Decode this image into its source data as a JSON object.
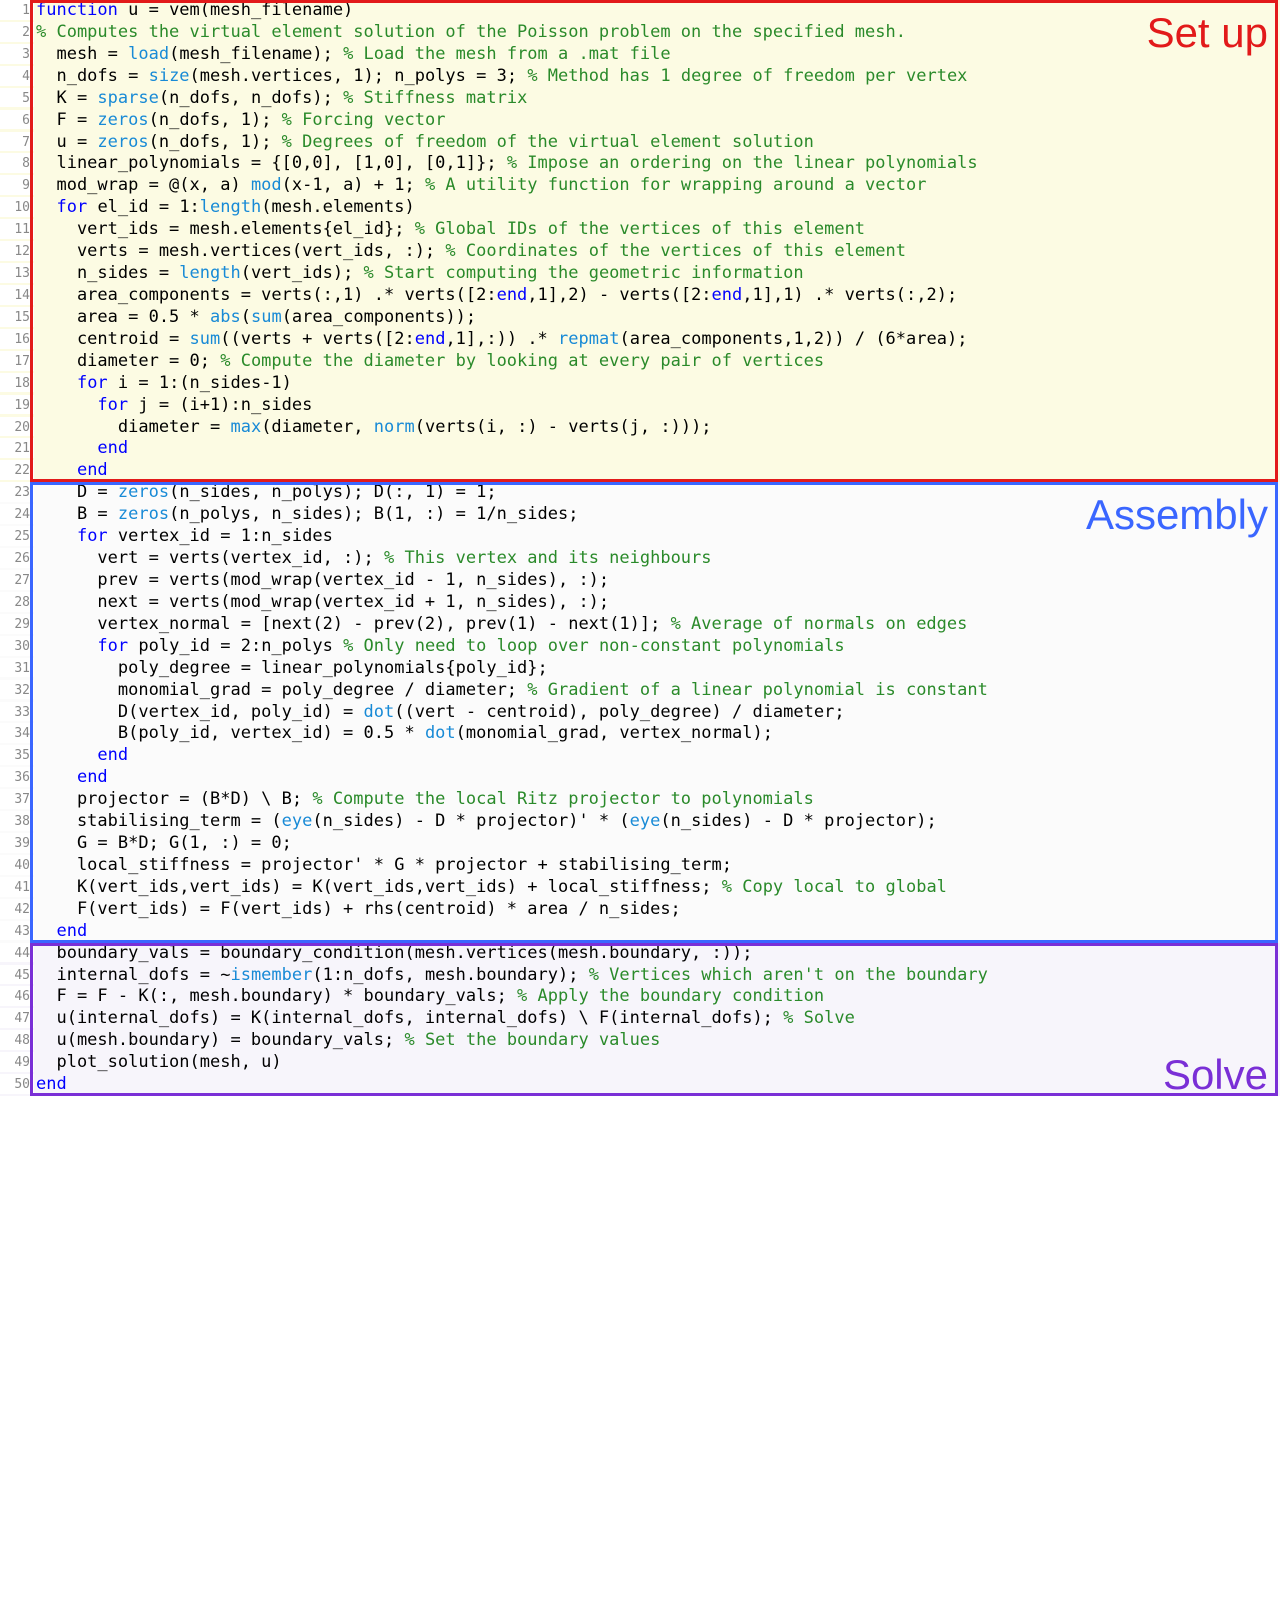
{
  "sections": {
    "setup": {
      "label": "Set up",
      "start": 1,
      "end": 22,
      "bg": "bg-setup",
      "box": "box-setup",
      "labelClass": "label-setup",
      "labelTop": 6
    },
    "assembly": {
      "label": "Assembly",
      "start": 23,
      "end": 43,
      "bg": "bg-assembly",
      "box": "box-assembly",
      "labelClass": "label-assembly",
      "labelTop": 6
    },
    "solve": {
      "label": "Solve",
      "start": 44,
      "end": 50,
      "bg": "bg-solve",
      "box": "box-solve",
      "labelClass": "label-solve",
      "labelBottom": 2
    }
  },
  "lines": [
    {
      "n": 1,
      "sec": "setup",
      "t": [
        [
          "kw",
          "function"
        ],
        [
          "",
          " u = vem(mesh_filename)"
        ]
      ]
    },
    {
      "n": 2,
      "sec": "setup",
      "t": [
        [
          "cm",
          "% Computes the virtual element solution of the Poisson problem on the specified mesh."
        ]
      ]
    },
    {
      "n": 3,
      "sec": "setup",
      "t": [
        [
          "",
          "  mesh = "
        ],
        [
          "fn",
          "load"
        ],
        [
          "",
          "(mesh_filename); "
        ],
        [
          "cm",
          "% Load the mesh from a .mat file"
        ]
      ]
    },
    {
      "n": 4,
      "sec": "setup",
      "t": [
        [
          "",
          "  n_dofs = "
        ],
        [
          "fn",
          "size"
        ],
        [
          "",
          "(mesh.vertices, 1); n_polys = 3; "
        ],
        [
          "cm",
          "% Method has 1 degree of freedom per vertex"
        ]
      ]
    },
    {
      "n": 5,
      "sec": "setup",
      "t": [
        [
          "",
          "  K = "
        ],
        [
          "fn",
          "sparse"
        ],
        [
          "",
          "(n_dofs, n_dofs); "
        ],
        [
          "cm",
          "% Stiffness matrix"
        ]
      ]
    },
    {
      "n": 6,
      "sec": "setup",
      "t": [
        [
          "",
          "  F = "
        ],
        [
          "fn",
          "zeros"
        ],
        [
          "",
          "(n_dofs, 1); "
        ],
        [
          "cm",
          "% Forcing vector"
        ]
      ]
    },
    {
      "n": 7,
      "sec": "setup",
      "t": [
        [
          "",
          "  u = "
        ],
        [
          "fn",
          "zeros"
        ],
        [
          "",
          "(n_dofs, 1); "
        ],
        [
          "cm",
          "% Degrees of freedom of the virtual element solution"
        ]
      ]
    },
    {
      "n": 8,
      "sec": "setup",
      "t": [
        [
          "",
          "  linear_polynomials = {[0,0], [1,0], [0,1]}; "
        ],
        [
          "cm",
          "% Impose an ordering on the linear polynomials"
        ]
      ]
    },
    {
      "n": 9,
      "sec": "setup",
      "t": [
        [
          "",
          "  mod_wrap = @(x, a) "
        ],
        [
          "fn",
          "mod"
        ],
        [
          "",
          "(x-1, a) + 1; "
        ],
        [
          "cm",
          "% A utility function for wrapping around a vector"
        ]
      ]
    },
    {
      "n": 10,
      "sec": "setup",
      "t": [
        [
          "",
          "  "
        ],
        [
          "kw",
          "for"
        ],
        [
          "",
          " el_id = 1:"
        ],
        [
          "fn",
          "length"
        ],
        [
          "",
          "(mesh.elements)"
        ]
      ]
    },
    {
      "n": 11,
      "sec": "setup",
      "t": [
        [
          "",
          "    vert_ids = mesh.elements{el_id}; "
        ],
        [
          "cm",
          "% Global IDs of the vertices of this element"
        ]
      ]
    },
    {
      "n": 12,
      "sec": "setup",
      "t": [
        [
          "",
          "    verts = mesh.vertices(vert_ids, :); "
        ],
        [
          "cm",
          "% Coordinates of the vertices of this element"
        ]
      ]
    },
    {
      "n": 13,
      "sec": "setup",
      "t": [
        [
          "",
          "    n_sides = "
        ],
        [
          "fn",
          "length"
        ],
        [
          "",
          "(vert_ids); "
        ],
        [
          "cm",
          "% Start computing the geometric information"
        ]
      ]
    },
    {
      "n": 14,
      "sec": "setup",
      "t": [
        [
          "",
          "    area_components = verts(:,1) .* verts([2:"
        ],
        [
          "kw",
          "end"
        ],
        [
          "",
          ",1],2) - verts([2:"
        ],
        [
          "kw",
          "end"
        ],
        [
          "",
          ",1],1) .* verts(:,2);"
        ]
      ]
    },
    {
      "n": 15,
      "sec": "setup",
      "t": [
        [
          "",
          "    area = 0.5 * "
        ],
        [
          "fn",
          "abs"
        ],
        [
          "",
          "("
        ],
        [
          "fn",
          "sum"
        ],
        [
          "",
          "(area_components));"
        ]
      ]
    },
    {
      "n": 16,
      "sec": "setup",
      "t": [
        [
          "",
          "    centroid = "
        ],
        [
          "fn",
          "sum"
        ],
        [
          "",
          "((verts + verts([2:"
        ],
        [
          "kw",
          "end"
        ],
        [
          "",
          ",1],:)) .* "
        ],
        [
          "fn",
          "repmat"
        ],
        [
          "",
          "(area_components,1,2)) / (6*area);"
        ]
      ]
    },
    {
      "n": 17,
      "sec": "setup",
      "t": [
        [
          "",
          "    diameter = 0; "
        ],
        [
          "cm",
          "% Compute the diameter by looking at every pair of vertices"
        ]
      ]
    },
    {
      "n": 18,
      "sec": "setup",
      "t": [
        [
          "",
          "    "
        ],
        [
          "kw",
          "for"
        ],
        [
          "",
          " i = 1:(n_sides-1)"
        ]
      ]
    },
    {
      "n": 19,
      "sec": "setup",
      "t": [
        [
          "",
          "      "
        ],
        [
          "kw",
          "for"
        ],
        [
          "",
          " j = (i+1):n_sides"
        ]
      ]
    },
    {
      "n": 20,
      "sec": "setup",
      "t": [
        [
          "",
          "        diameter = "
        ],
        [
          "fn",
          "max"
        ],
        [
          "",
          "(diameter, "
        ],
        [
          "fn",
          "norm"
        ],
        [
          "",
          "(verts(i, :) - verts(j, :)));"
        ]
      ]
    },
    {
      "n": 21,
      "sec": "setup",
      "t": [
        [
          "",
          "      "
        ],
        [
          "kw",
          "end"
        ]
      ]
    },
    {
      "n": 22,
      "sec": "setup",
      "t": [
        [
          "",
          "    "
        ],
        [
          "kw",
          "end"
        ]
      ]
    },
    {
      "n": 23,
      "sec": "assembly",
      "t": [
        [
          "",
          "    D = "
        ],
        [
          "fn",
          "zeros"
        ],
        [
          "",
          "(n_sides, n_polys); D(:, 1) = 1;"
        ]
      ]
    },
    {
      "n": 24,
      "sec": "assembly",
      "t": [
        [
          "",
          "    B = "
        ],
        [
          "fn",
          "zeros"
        ],
        [
          "",
          "(n_polys, n_sides); B(1, :) = 1/n_sides;"
        ]
      ]
    },
    {
      "n": 25,
      "sec": "assembly",
      "t": [
        [
          "",
          "    "
        ],
        [
          "kw",
          "for"
        ],
        [
          "",
          " vertex_id = 1:n_sides"
        ]
      ]
    },
    {
      "n": 26,
      "sec": "assembly",
      "t": [
        [
          "",
          "      vert = verts(vertex_id, :); "
        ],
        [
          "cm",
          "% This vertex and its neighbours"
        ]
      ]
    },
    {
      "n": 27,
      "sec": "assembly",
      "t": [
        [
          "",
          "      prev = verts(mod_wrap(vertex_id - 1, n_sides), :);"
        ]
      ]
    },
    {
      "n": 28,
      "sec": "assembly",
      "t": [
        [
          "",
          "      next = verts(mod_wrap(vertex_id + 1, n_sides), :);"
        ]
      ]
    },
    {
      "n": 29,
      "sec": "assembly",
      "t": [
        [
          "",
          "      vertex_normal = [next(2) - prev(2), prev(1) - next(1)]; "
        ],
        [
          "cm",
          "% Average of normals on edges"
        ]
      ]
    },
    {
      "n": 30,
      "sec": "assembly",
      "t": [
        [
          "",
          "      "
        ],
        [
          "kw",
          "for"
        ],
        [
          "",
          " poly_id = 2:n_polys "
        ],
        [
          "cm",
          "% Only need to loop over non-constant polynomials"
        ]
      ]
    },
    {
      "n": 31,
      "sec": "assembly",
      "t": [
        [
          "",
          "        poly_degree = linear_polynomials{poly_id};"
        ]
      ]
    },
    {
      "n": 32,
      "sec": "assembly",
      "t": [
        [
          "",
          "        monomial_grad = poly_degree / diameter; "
        ],
        [
          "cm",
          "% Gradient of a linear polynomial is constant"
        ]
      ]
    },
    {
      "n": 33,
      "sec": "assembly",
      "t": [
        [
          "",
          "        D(vertex_id, poly_id) = "
        ],
        [
          "fn",
          "dot"
        ],
        [
          "",
          "((vert - centroid), poly_degree) / diameter;"
        ]
      ]
    },
    {
      "n": 34,
      "sec": "assembly",
      "t": [
        [
          "",
          "        B(poly_id, vertex_id) = 0.5 * "
        ],
        [
          "fn",
          "dot"
        ],
        [
          "",
          "(monomial_grad, vertex_normal);"
        ]
      ]
    },
    {
      "n": 35,
      "sec": "assembly",
      "t": [
        [
          "",
          "      "
        ],
        [
          "kw",
          "end"
        ]
      ]
    },
    {
      "n": 36,
      "sec": "assembly",
      "t": [
        [
          "",
          "    "
        ],
        [
          "kw",
          "end"
        ]
      ]
    },
    {
      "n": 37,
      "sec": "assembly",
      "t": [
        [
          "",
          "    projector = (B*D) \\ B; "
        ],
        [
          "cm",
          "% Compute the local Ritz projector to polynomials"
        ]
      ]
    },
    {
      "n": 38,
      "sec": "assembly",
      "t": [
        [
          "",
          "    stabilising_term = ("
        ],
        [
          "fn",
          "eye"
        ],
        [
          "",
          "(n_sides) - D * projector)' * ("
        ],
        [
          "fn",
          "eye"
        ],
        [
          "",
          "(n_sides) - D * projector);"
        ]
      ]
    },
    {
      "n": 39,
      "sec": "assembly",
      "t": [
        [
          "",
          "    G = B*D; G(1, :) = 0;"
        ]
      ]
    },
    {
      "n": 40,
      "sec": "assembly",
      "t": [
        [
          "",
          "    local_stiffness = projector' * G * projector + stabilising_term;"
        ]
      ]
    },
    {
      "n": 41,
      "sec": "assembly",
      "t": [
        [
          "",
          "    K(vert_ids,vert_ids) = K(vert_ids,vert_ids) + local_stiffness; "
        ],
        [
          "cm",
          "% Copy local to global"
        ]
      ]
    },
    {
      "n": 42,
      "sec": "assembly",
      "t": [
        [
          "",
          "    F(vert_ids) = F(vert_ids) + rhs(centroid) * area / n_sides;"
        ]
      ]
    },
    {
      "n": 43,
      "sec": "assembly",
      "t": [
        [
          "",
          "  "
        ],
        [
          "kw",
          "end"
        ]
      ]
    },
    {
      "n": 44,
      "sec": "solve",
      "t": [
        [
          "",
          "  boundary_vals = boundary_condition(mesh.vertices(mesh.boundary, :));"
        ]
      ]
    },
    {
      "n": 45,
      "sec": "solve",
      "t": [
        [
          "",
          "  internal_dofs = ~"
        ],
        [
          "fn",
          "ismember"
        ],
        [
          "",
          "(1:n_dofs, mesh.boundary); "
        ],
        [
          "cm",
          "% Vertices which aren't on the boundary"
        ]
      ]
    },
    {
      "n": 46,
      "sec": "solve",
      "t": [
        [
          "",
          "  F = F - K(:, mesh.boundary) * boundary_vals; "
        ],
        [
          "cm",
          "% Apply the boundary condition"
        ]
      ]
    },
    {
      "n": 47,
      "sec": "solve",
      "t": [
        [
          "",
          "  u(internal_dofs) = K(internal_dofs, internal_dofs) \\ F(internal_dofs); "
        ],
        [
          "cm",
          "% Solve"
        ]
      ]
    },
    {
      "n": 48,
      "sec": "solve",
      "t": [
        [
          "",
          "  u(mesh.boundary) = boundary_vals; "
        ],
        [
          "cm",
          "% Set the boundary values"
        ]
      ]
    },
    {
      "n": 49,
      "sec": "solve",
      "t": [
        [
          "",
          "  plot_solution(mesh, u)"
        ]
      ]
    },
    {
      "n": 50,
      "sec": "solve",
      "t": [
        [
          "kw",
          "end"
        ]
      ]
    }
  ]
}
